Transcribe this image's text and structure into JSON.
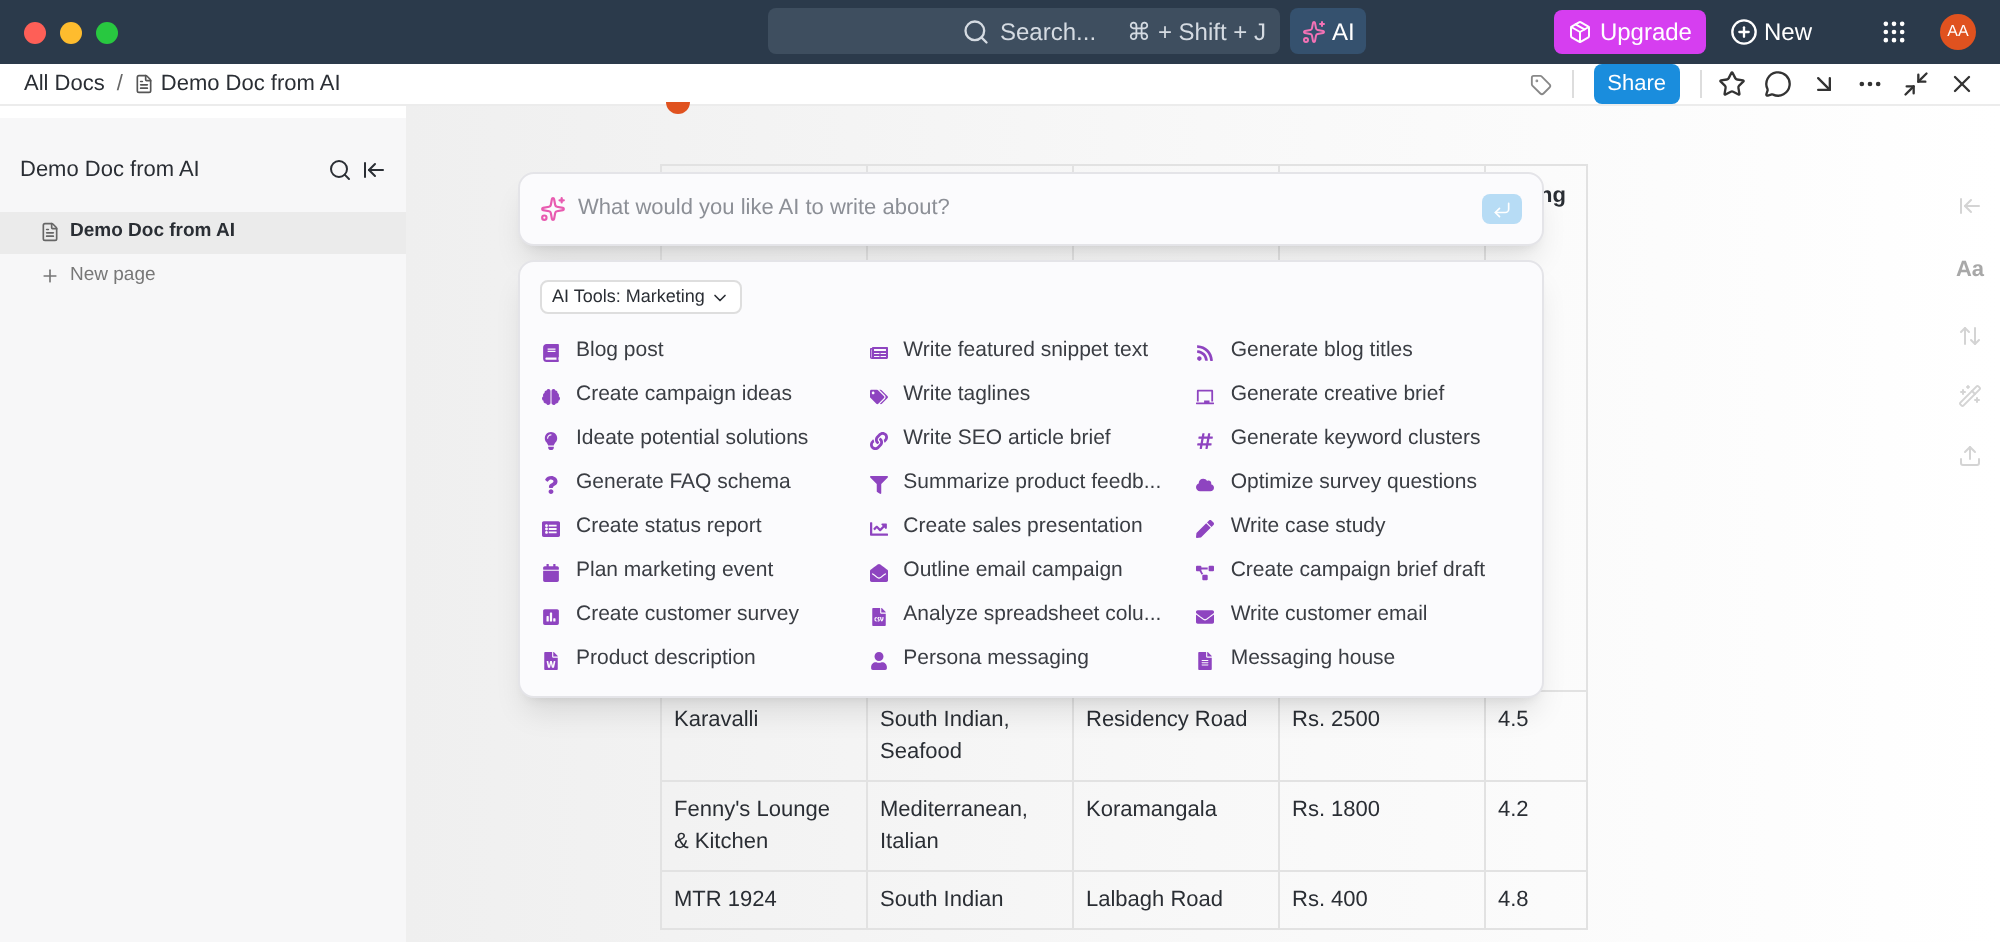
{
  "topbar": {
    "search": {
      "placeholder": "Search...",
      "shortcut": "⌘ + Shift + J"
    },
    "ai_button": "AI",
    "upgrade_button": "Upgrade",
    "new_button": "New",
    "avatar": "AA"
  },
  "breadcrumb": [
    "All Docs",
    "Demo Doc from AI"
  ],
  "breadcrumb_separator": "/",
  "share_button": "Share",
  "sidebar": {
    "title": "Demo Doc from AI",
    "items": [
      {
        "label": "Demo Doc from AI",
        "selected": true
      }
    ],
    "new_page": "New page"
  },
  "table": {
    "header_visible": "ng",
    "rows": [
      [
        "Karavalli",
        "South Indian, Seafood",
        "Residency Road",
        "Rs. 2500",
        "4.5"
      ],
      [
        "Fenny's Lounge & Kitchen",
        "Mediterranean, Italian",
        "Koramangala",
        "Rs. 1800",
        "4.2"
      ],
      [
        "MTR 1924",
        "South Indian",
        "Lalbagh Road",
        "Rs. 400",
        "4.8"
      ]
    ]
  },
  "ai_prompt": {
    "placeholder": "What would you like AI to write about?"
  },
  "ai_tools": {
    "dropdown": "AI Tools: Marketing",
    "items": [
      "Blog post",
      "Write featured snippet text",
      "Generate blog titles",
      "Create campaign ideas",
      "Write taglines",
      "Generate creative brief",
      "Ideate potential solutions",
      "Write SEO article brief",
      "Generate keyword clusters",
      "Generate FAQ schema",
      "Summarize product feedb...",
      "Optimize survey questions",
      "Create status report",
      "Create sales presentation",
      "Write case study",
      "Plan marketing event",
      "Outline email campaign",
      "Create campaign brief draft",
      "Create customer survey",
      "Analyze spreadsheet colu...",
      "Write customer email",
      "Product description",
      "Persona messaging",
      "Messaging house"
    ]
  },
  "right_rail": {
    "text_style": "Aa"
  }
}
